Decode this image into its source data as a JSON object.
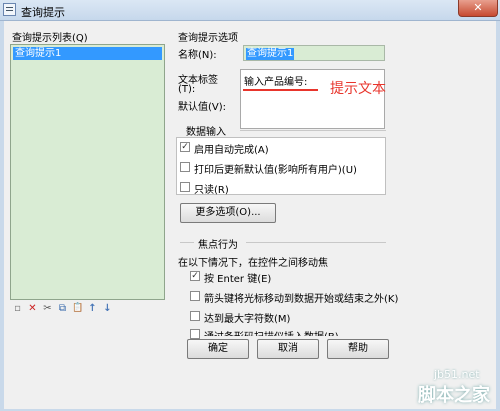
{
  "window": {
    "title": "查询提示",
    "close_glyph": "✕"
  },
  "list_panel": {
    "label": "查询提示列表(Q)",
    "items": [
      "查询提示1"
    ],
    "toolbar_icons": [
      "new-icon",
      "delete-icon",
      "cut-icon",
      "copy-icon",
      "paste-icon",
      "move-up-icon",
      "move-down-icon"
    ],
    "toolbar_glyphs": [
      "▫",
      "✕",
      "✂",
      "⧉",
      "📋",
      "↑",
      "↓"
    ]
  },
  "options": {
    "group_label": "查询提示选项",
    "name_label": "名称(N):",
    "name_value": "查询提示1",
    "text_label_line1": "文本标签",
    "text_label_line2": "(T):",
    "text_value": "输入产品编号:",
    "default_label": "默认值(V):",
    "annotation": "提示文本"
  },
  "data_input": {
    "group_label": "数据输入",
    "checkboxes": [
      {
        "label": "启用自动完成(A)",
        "checked": true,
        "mark": "✓"
      },
      {
        "label": "打印后更新默认值(影响所有用户)(U)",
        "checked": false,
        "mark": ""
      },
      {
        "label": "只读(R)",
        "checked": false,
        "mark": ""
      }
    ],
    "more_button": "更多选项(O)..."
  },
  "focus": {
    "group_label": "焦点行为",
    "description": "在以下情况下，在控件之间移动焦",
    "checkboxes": [
      {
        "label": "按 Enter 键(E)",
        "checked": true,
        "mark": "✓"
      },
      {
        "label": "箭头键将光标移动到数据开始或结束之外(K)",
        "checked": false,
        "mark": ""
      },
      {
        "label": "达到最大字符数(M)",
        "checked": false,
        "mark": ""
      },
      {
        "label": "通过条形码扫描仪插入数据(B)",
        "checked": false,
        "mark": ""
      }
    ]
  },
  "buttons": {
    "ok": "确定",
    "cancel": "取消",
    "help": "帮助"
  },
  "watermark": {
    "line1": "jb51.net",
    "line2": "脚本之家"
  }
}
